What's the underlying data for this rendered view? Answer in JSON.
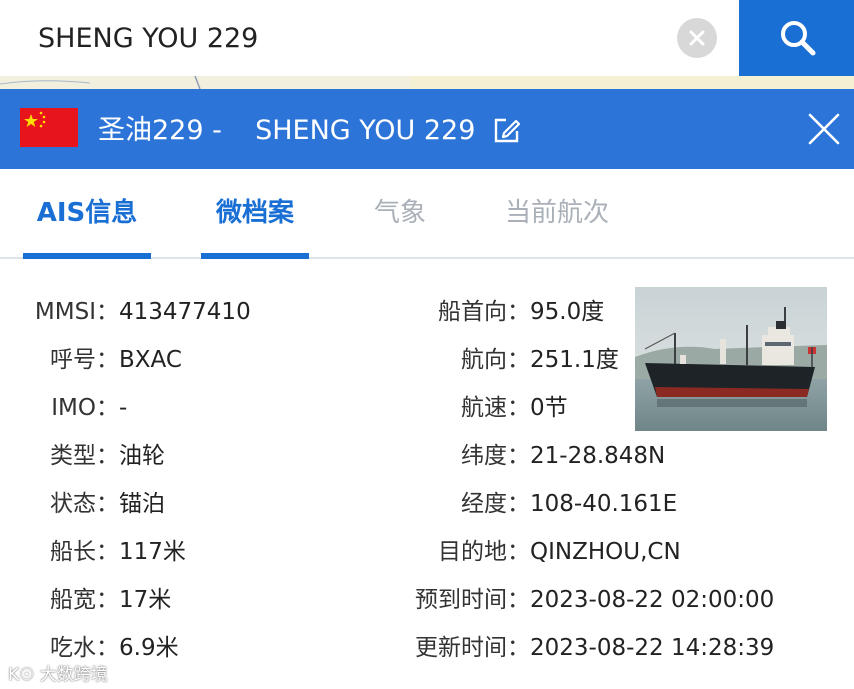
{
  "search": {
    "value": "SHENG YOU 229",
    "clear_icon": "clear-x-icon",
    "search_icon": "magnifier-icon"
  },
  "header": {
    "flag_icon": "china-flag-icon",
    "name_cn": "圣油229 -",
    "name_en": "SHENG YOU 229",
    "edit_icon": "edit-pencil-icon",
    "close_icon": "close-x-icon",
    "bg_color": "#2c74d8"
  },
  "tabs": [
    {
      "label": "AIS信息",
      "active": true
    },
    {
      "label": "微档案",
      "active": true
    },
    {
      "label": "气象",
      "active": false
    },
    {
      "label": "当前航次",
      "active": false
    }
  ],
  "details_left": [
    {
      "label": "MMSI：",
      "value": "413477410"
    },
    {
      "label": "呼号：",
      "value": "BXAC"
    },
    {
      "label": "IMO：",
      "value": "-"
    },
    {
      "label": "类型：",
      "value": "油轮"
    },
    {
      "label": "状态：",
      "value": "锚泊"
    },
    {
      "label": "船长：",
      "value": "117米"
    },
    {
      "label": "船宽：",
      "value": "17米"
    },
    {
      "label": "吃水：",
      "value": "6.9米"
    }
  ],
  "details_right": [
    {
      "label": "船首向：",
      "value": "95.0度"
    },
    {
      "label": "航向：",
      "value": "251.1度"
    },
    {
      "label": "航速：",
      "value": "0节"
    },
    {
      "label": "纬度：",
      "value": "21-28.848N"
    },
    {
      "label": "经度：",
      "value": "108-40.161E"
    },
    {
      "label": "目的地：",
      "value": "QINZHOU,CN"
    },
    {
      "label": "预到时间：",
      "value": "2023-08-22 02:00:00"
    },
    {
      "label": "更新时间：",
      "value": "2023-08-22 14:28:39"
    }
  ],
  "photo": {
    "icon": "ship-photo"
  },
  "watermark": "大数跨境",
  "colors": {
    "accent": "#1a6fd4",
    "inactive_tab": "#aab0b8"
  }
}
